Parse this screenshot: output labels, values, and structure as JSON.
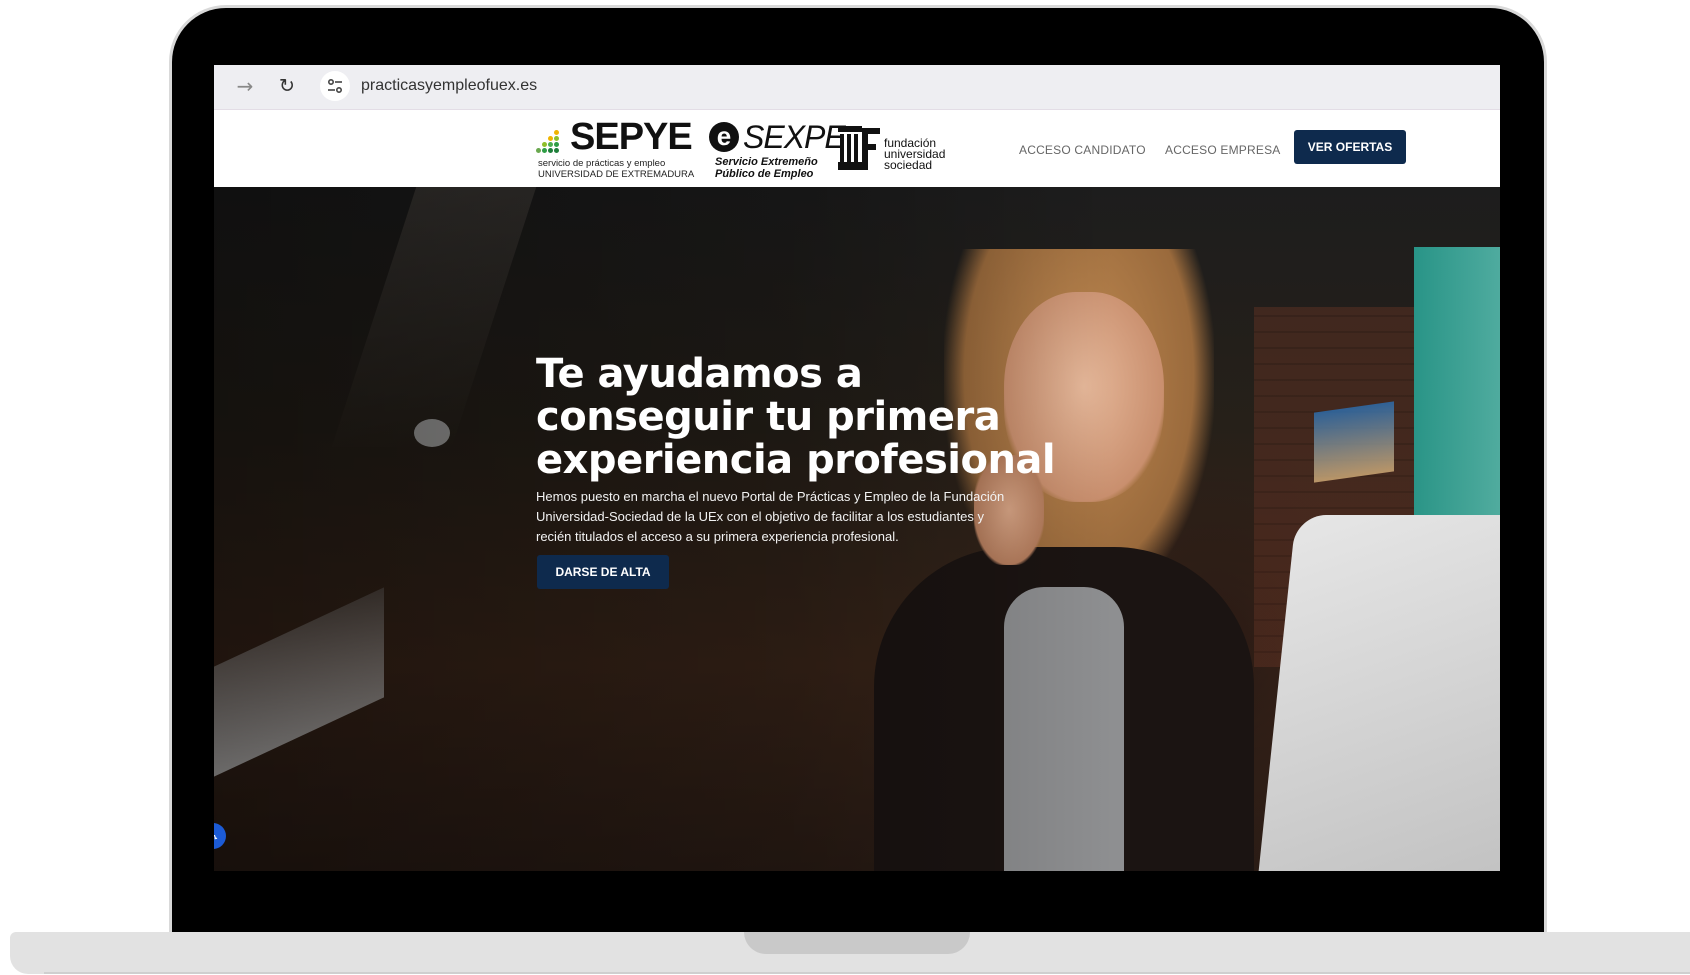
{
  "browser": {
    "forward_icon": "arrow-right-icon",
    "reload_icon": "reload-icon",
    "site_info_icon": "tune-icon",
    "url": "practicasyempleofuex.es"
  },
  "header": {
    "logos": {
      "sepye": {
        "name": "SEPYE",
        "line1": "servicio de prácticas y empleo",
        "line2": "UNIVERSIDAD DE EXTREMADURA"
      },
      "sexpe": {
        "name": "SEXPE",
        "line1": "Servicio Extremeño",
        "line2": "Público de Empleo"
      },
      "fundacion": {
        "line1": "fundación",
        "line2": "universidad",
        "line3": "sociedad"
      }
    },
    "nav": {
      "candidato": "ACCESO CANDIDATO",
      "empresa": "ACCESO EMPRESA",
      "ofertas_button": "VER OFERTAS"
    }
  },
  "hero": {
    "title_line1": "Te ayudamos a",
    "title_line2": "conseguir tu primera",
    "title_line3": "experiencia profesional",
    "description": "Hemos puesto en marcha el nuevo Portal de Prácticas y Empleo de la Fundación Universidad-Sociedad de la UEx con el objetivo de facilitar a los estudiantes y recién titulados el acceso a su primera experiencia profesional.",
    "cta_button": "DARSE DE ALTA"
  },
  "colors": {
    "primary_button": "#0e2a4d",
    "accessibility_badge": "#1c5bd6"
  }
}
